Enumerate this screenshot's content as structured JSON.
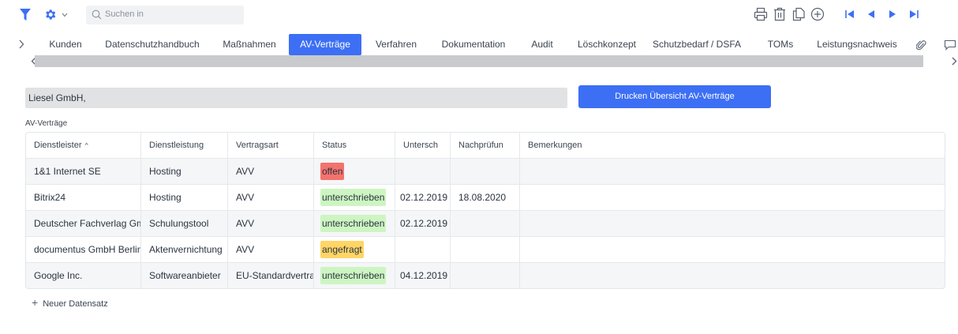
{
  "toolbar": {
    "icons": [
      "filter-icon",
      "gear-icon",
      "chevron-down-icon",
      "search-icon",
      "print-icon",
      "delete-icon",
      "copy-icon",
      "add-circle-icon",
      "first-record-icon",
      "previous-record-icon",
      "next-record-icon",
      "last-record-icon"
    ],
    "search_placeholder": "Suchen in"
  },
  "tabs": [
    {
      "label": "Kunden",
      "active": false
    },
    {
      "label": "Datenschutzhandbuch",
      "active": false
    },
    {
      "label": "Maßnahmen",
      "active": false
    },
    {
      "label": "AV-Verträge",
      "active": true
    },
    {
      "label": "Verfahren",
      "active": false
    },
    {
      "label": "Dokumentation",
      "active": false
    },
    {
      "label": "Audit",
      "active": false
    },
    {
      "label": "Löschkonzept",
      "active": false
    },
    {
      "label": "Schutzbedarf / DSFA",
      "active": false
    },
    {
      "label": "TOMs",
      "active": false
    },
    {
      "label": "Leistungsnachweis",
      "active": false
    }
  ],
  "tab_icons": [
    "tabs-scroll-icon",
    "attachment-icon",
    "comment-icon"
  ],
  "form": {
    "company": "Liesel GmbH,",
    "print_button": "Drucken Übersicht AV-Verträge"
  },
  "section_label": "AV-Verträge",
  "table": {
    "columns": [
      "Dienstleister",
      "Dienstleistung",
      "Vertragsart",
      "Status",
      "Untersch",
      "Nachprüfun",
      "Bemerkungen"
    ],
    "sort_column": "Dienstleister",
    "rows": [
      {
        "dienstleister": "1&1 Internet SE",
        "dienstleistung": "Hosting",
        "vertragsart": "AVV",
        "status": "offen",
        "untersch": "",
        "nachpruefung": "",
        "bemerkungen": ""
      },
      {
        "dienstleister": "Bitrix24",
        "dienstleistung": "Hosting",
        "vertragsart": "AVV",
        "status": "unterschrieben",
        "untersch": "02.12.2019",
        "nachpruefung": "18.08.2020",
        "bemerkungen": ""
      },
      {
        "dienstleister": "Deutscher Fachverlag GmbH",
        "dienstleistung": "Schulungstool",
        "vertragsart": "AVV",
        "status": "unterschrieben",
        "untersch": "02.12.2019",
        "nachpruefung": "",
        "bemerkungen": ""
      },
      {
        "dienstleister": "documentus GmbH Berlin &",
        "dienstleistung": "Aktenvernichtung",
        "vertragsart": "AVV",
        "status": "angefragt",
        "untersch": "",
        "nachpruefung": "",
        "bemerkungen": ""
      },
      {
        "dienstleister": "Google Inc.",
        "dienstleistung": "Softwareanbieter",
        "vertragsart": "EU-Standardvertrag",
        "status": "unterschrieben",
        "untersch": "04.12.2019",
        "nachpruefung": "",
        "bemerkungen": ""
      }
    ]
  },
  "new_record": "Neuer Datensatz",
  "colors": {
    "accent": "#3d6ff5",
    "status_offen": "#f4726e",
    "status_unterschrieben": "#cdf5c2",
    "status_angefragt": "#ffd565"
  }
}
